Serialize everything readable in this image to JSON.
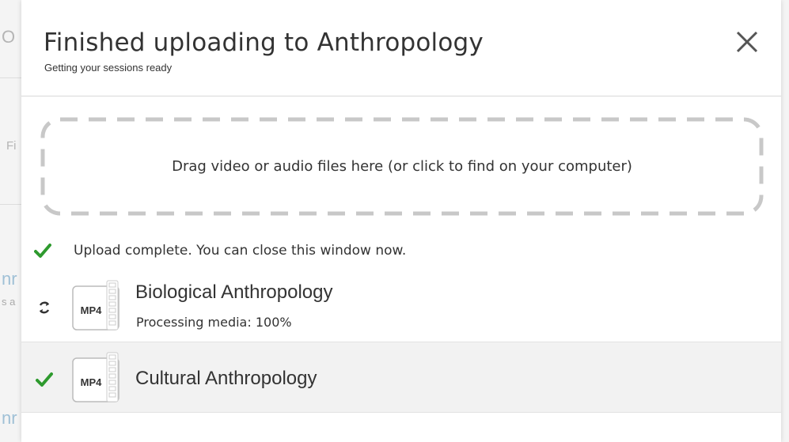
{
  "background": {
    "fragments": [
      "O",
      "Fi",
      "nr",
      "s a",
      "nr"
    ]
  },
  "modal": {
    "title": "Finished uploading to Anthropology",
    "subtitle": "Getting your sessions ready",
    "close_icon": "close-icon"
  },
  "dropzone": {
    "text": "Drag video or audio files here (or click to find on your computer)"
  },
  "status": {
    "text": "Upload complete. You can close this window now.",
    "icon": "check-icon",
    "color": "#2e9a2e"
  },
  "files": [
    {
      "name": "Biological Anthropology",
      "type": "MP4",
      "progress_text": "Processing media: 100%",
      "status_icon": "refresh-icon"
    },
    {
      "name": "Cultural Anthropology",
      "type": "MP4",
      "status_icon": "check-icon"
    }
  ],
  "colors": {
    "dashed_border": "#c8c8c8",
    "check": "#2e9a2e",
    "row_highlight": "#f2f2f2"
  }
}
